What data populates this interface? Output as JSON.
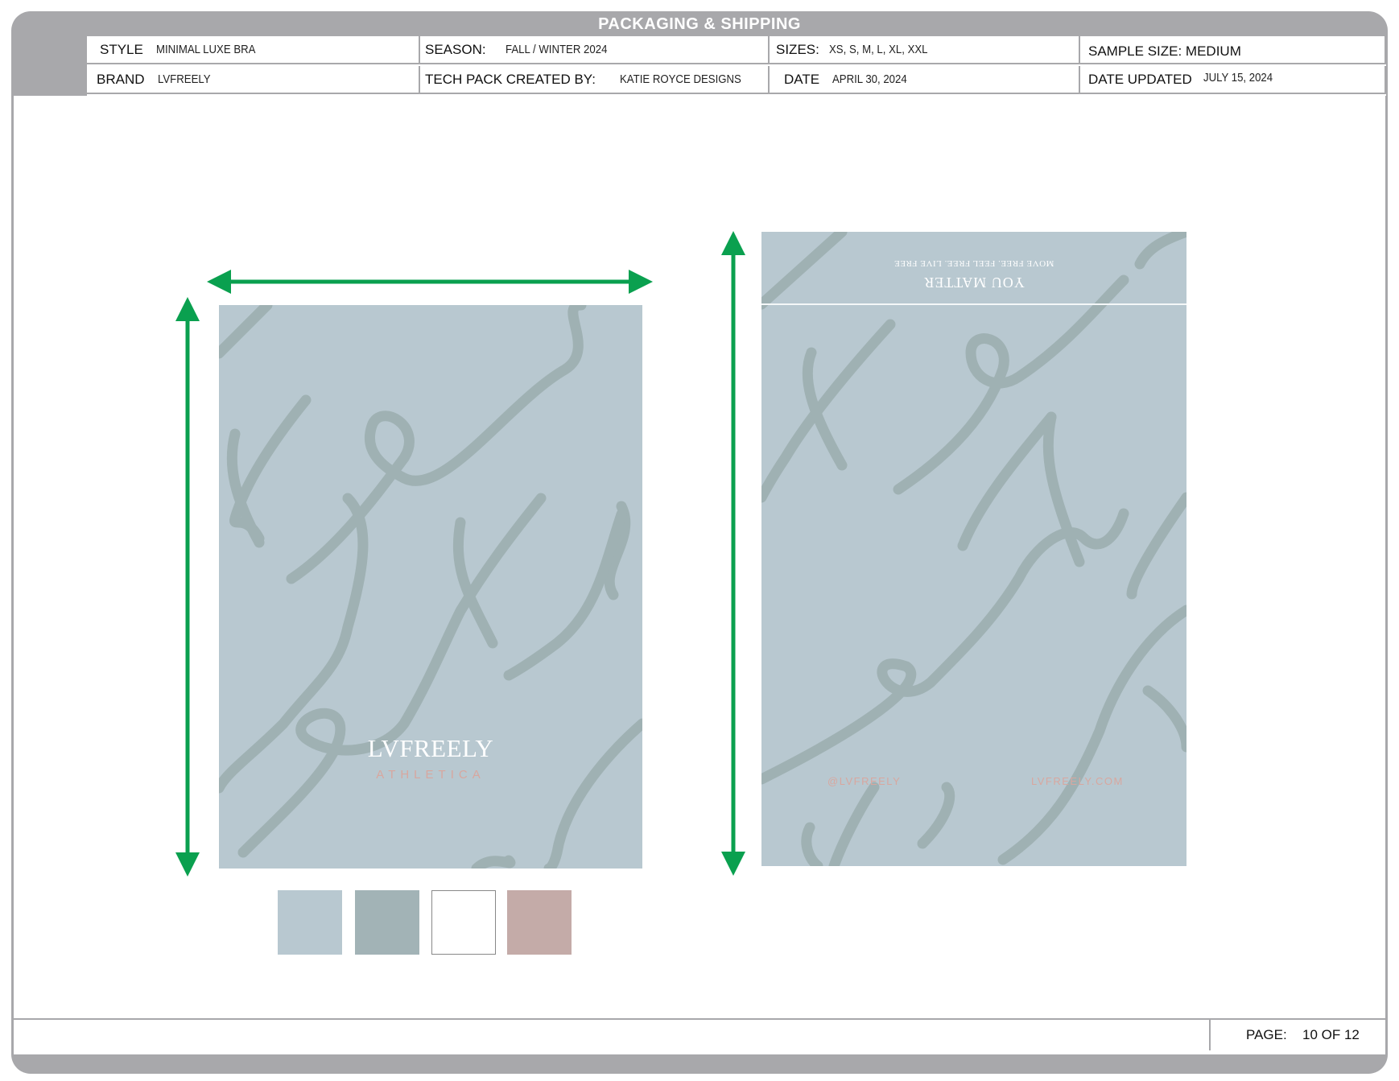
{
  "header": {
    "title": "PACKAGING & SHIPPING",
    "style_label": "STYLE",
    "style_value": "MINIMAL LUXE BRA",
    "season_label": "SEASON:",
    "season_value": "FALL / WINTER 2024",
    "sizes_label": "SIZES:",
    "sizes_value": "XS, S, M, L, XL, XXL",
    "sample_size": "SAMPLE SIZE: MEDIUM",
    "brand_label": "BRAND",
    "brand_value": "LVFREELY",
    "created_by_label": "TECH PACK CREATED BY:",
    "created_by_value": "KATIE ROYCE DESIGNS",
    "date_label": "DATE",
    "date_value": "APRIL 30, 2024",
    "updated_label": "DATE UPDATED",
    "updated_value": "JULY 15, 2024"
  },
  "front_bag": {
    "logo": "LVFREELY",
    "sub": "ATHLETICA",
    "color": "#b8c8d0"
  },
  "back_bag": {
    "flap_line_1": "YOU MATTER",
    "flap_line_2": "MOVE FREE. FEEL FREE. LIVE FREE",
    "handle": "@LVFREELY",
    "website": "LVFREELY.COM"
  },
  "swatches": [
    {
      "color": "#b8c8d0"
    },
    {
      "color": "#a2b3b6"
    },
    {
      "color": "#ffffff"
    },
    {
      "color": "#c4aba8"
    }
  ],
  "arrow_color": "#0aa04f",
  "footer": {
    "page_label": "PAGE:",
    "page_value": "10 OF 12"
  }
}
